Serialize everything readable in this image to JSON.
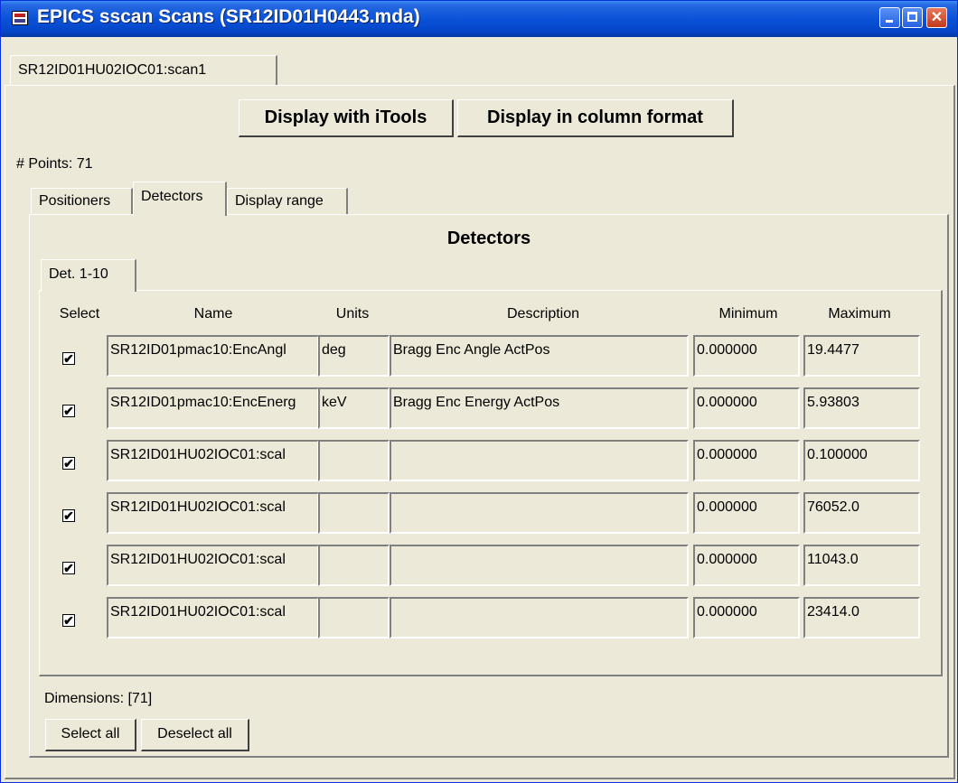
{
  "window": {
    "title": "EPICS sscan Scans (SR12ID01H0443.mda)"
  },
  "outer_tab": "SR12ID01HU02IOC01:scan1",
  "buttons": {
    "itools": "Display with iTools",
    "column": "Display in column format",
    "select_all": "Select all",
    "deselect_all": "Deselect all"
  },
  "points_label": "# Points: 71",
  "inner_tabs": [
    "Positioners",
    "Detectors",
    "Display range"
  ],
  "section_title": "Detectors",
  "det_tab": "Det. 1-10",
  "headers": {
    "select": "Select",
    "name": "Name",
    "units": "Units",
    "description": "Description",
    "minimum": "Minimum",
    "maximum": "Maximum"
  },
  "rows": [
    {
      "checked": true,
      "name": "SR12ID01pmac10:EncAngl",
      "units": "deg",
      "description": "Bragg Enc Angle ActPos",
      "minimum": "0.000000",
      "maximum": "19.4477"
    },
    {
      "checked": true,
      "name": "SR12ID01pmac10:EncEnerg",
      "units": "keV",
      "description": "Bragg Enc Energy ActPos",
      "minimum": "0.000000",
      "maximum": "5.93803"
    },
    {
      "checked": true,
      "name": "SR12ID01HU02IOC01:scal",
      "units": "",
      "description": "",
      "minimum": "0.000000",
      "maximum": "0.100000"
    },
    {
      "checked": true,
      "name": "SR12ID01HU02IOC01:scal",
      "units": "",
      "description": "",
      "minimum": "0.000000",
      "maximum": "76052.0"
    },
    {
      "checked": true,
      "name": "SR12ID01HU02IOC01:scal",
      "units": "",
      "description": "",
      "minimum": "0.000000",
      "maximum": "11043.0"
    },
    {
      "checked": true,
      "name": "SR12ID01HU02IOC01:scal",
      "units": "",
      "description": "",
      "minimum": "0.000000",
      "maximum": "23414.0"
    }
  ],
  "dimensions_label": "Dimensions: [71]",
  "check_mark": "✔"
}
